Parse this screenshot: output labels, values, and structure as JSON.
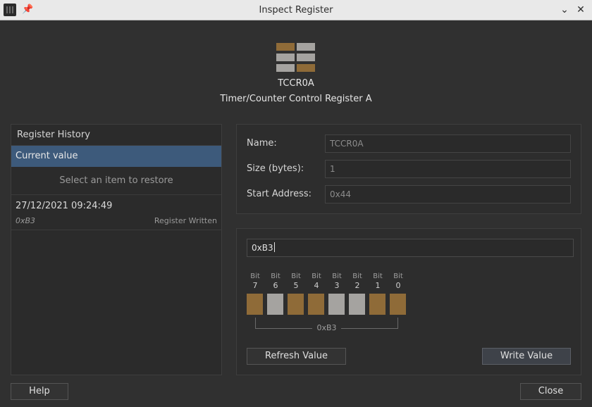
{
  "window": {
    "title": "Inspect Register",
    "icons": {
      "app": "app-icon",
      "pin": "pin-icon",
      "minimize": "chevron-down-icon",
      "close": "close-icon"
    }
  },
  "register": {
    "name": "TCCR0A",
    "description": "Timer/Counter Control Register A",
    "icon_colors": {
      "on": "#8f6b38",
      "off": "#a5a3a0"
    }
  },
  "history": {
    "header": "Register History",
    "current_label": "Current value",
    "restore_hint": "Select an item to restore",
    "items": [
      {
        "datetime": "27/12/2021 09:24:49",
        "value": "0xB3",
        "action": "Register Written"
      }
    ]
  },
  "details": {
    "name_label": "Name:",
    "name_value": "TCCR0A",
    "size_label": "Size (bytes):",
    "size_value": "1",
    "address_label": "Start Address:",
    "address_value": "0x44"
  },
  "value": {
    "input_value": "0xB3",
    "bit_word": "Bit",
    "bits": [
      {
        "index": "7",
        "set": true
      },
      {
        "index": "6",
        "set": false
      },
      {
        "index": "5",
        "set": true
      },
      {
        "index": "4",
        "set": true
      },
      {
        "index": "3",
        "set": false
      },
      {
        "index": "2",
        "set": false
      },
      {
        "index": "1",
        "set": true
      },
      {
        "index": "0",
        "set": true
      }
    ],
    "byte_label": "0xB3",
    "refresh_label": "Refresh Value",
    "write_label": "Write Value"
  },
  "footer": {
    "help_label": "Help",
    "close_label": "Close"
  },
  "colors": {
    "selection": "#3d5a7b",
    "background": "#303030",
    "bit_on": "#8f6b38",
    "bit_off": "#a5a3a0"
  }
}
